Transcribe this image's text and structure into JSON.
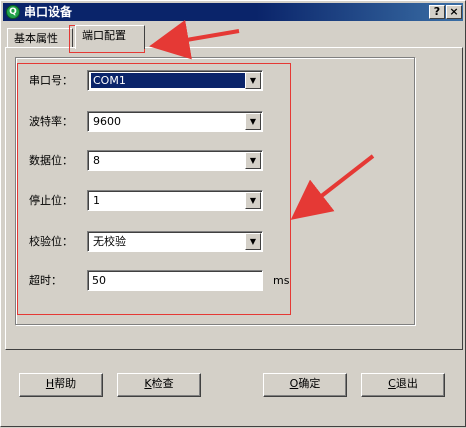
{
  "window": {
    "title": "串口设备",
    "help_button": "?",
    "close_button": "×"
  },
  "tabs": [
    {
      "label": "基本属性",
      "active": false
    },
    {
      "label": "端口配置",
      "active": true
    }
  ],
  "form": {
    "fields": [
      {
        "label": "串口号：",
        "value": "COM1"
      },
      {
        "label": "波特率：",
        "value": "9600"
      },
      {
        "label": "数据位：",
        "value": "8"
      },
      {
        "label": "停止位：",
        "value": "1"
      },
      {
        "label": "校验位：",
        "value": "无校验"
      }
    ],
    "timeout": {
      "label": "超时：",
      "value": "50",
      "unit": "ms"
    }
  },
  "buttons": {
    "help": {
      "key": "H",
      "label": "帮助"
    },
    "check": {
      "key": "K",
      "label": "检查"
    },
    "ok": {
      "key": "O",
      "label": "确定"
    },
    "cancel": {
      "key": "C",
      "label": "退出"
    }
  },
  "colors": {
    "annotation": "#e53935",
    "titlebar": "#0a246a",
    "selection": "#0a246a",
    "face": "#d4d0c8"
  }
}
